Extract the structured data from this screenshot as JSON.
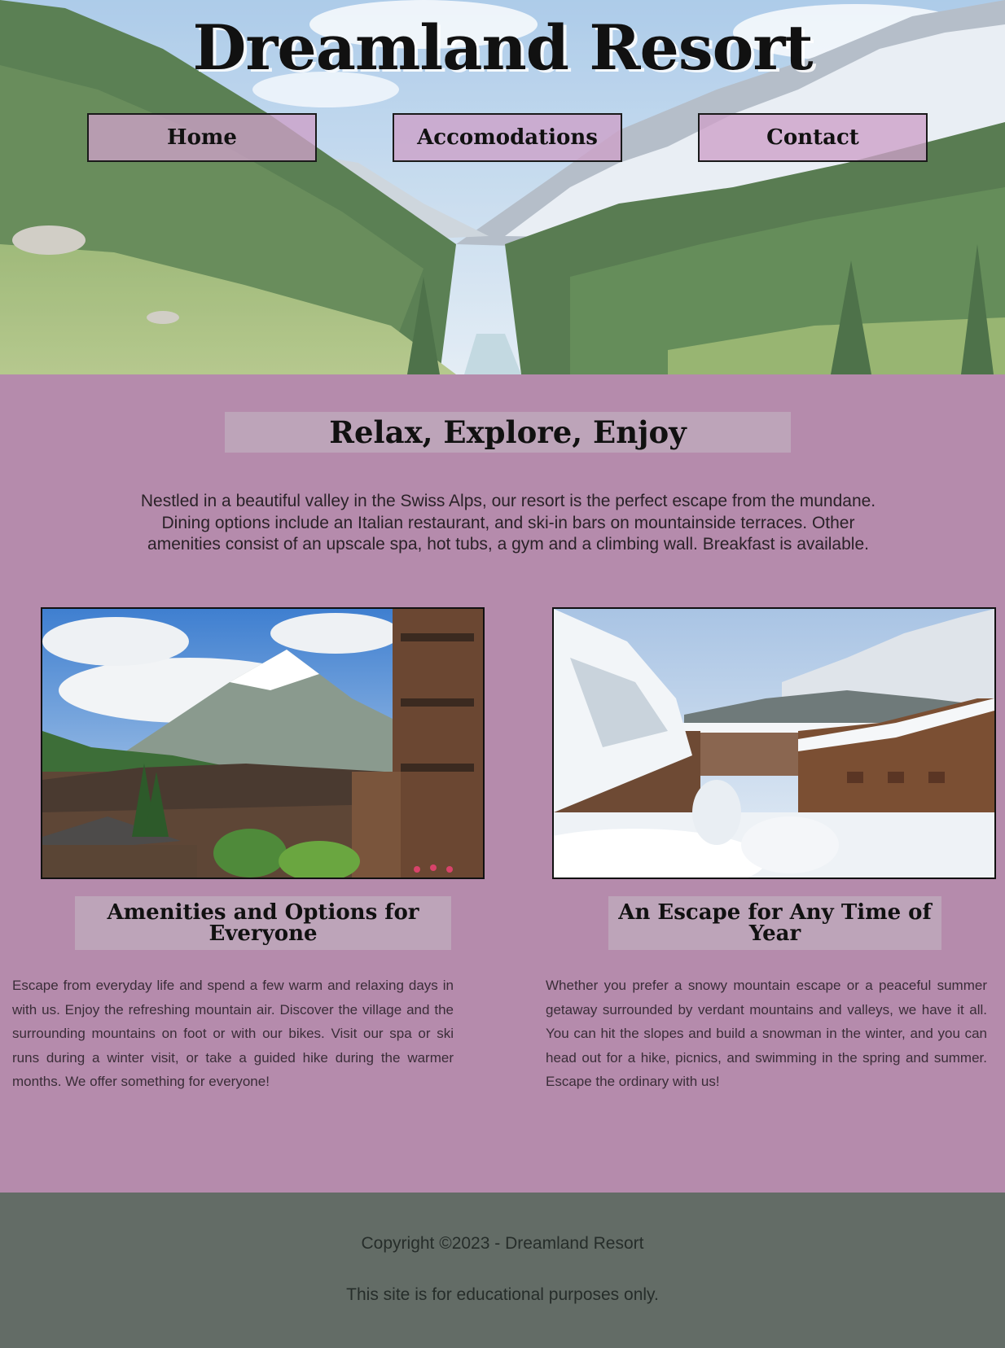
{
  "header": {
    "title": "Dreamland Resort",
    "nav": [
      {
        "label": "Home"
      },
      {
        "label": "Accomodations"
      },
      {
        "label": "Contact"
      }
    ]
  },
  "main": {
    "heading": "Relax, Explore, Enjoy",
    "intro": "Nestled in a beautiful valley in the Swiss Alps, our resort is the perfect escape from the mundane. Dining options include an Italian restaurant, and ski-in bars on mountainside terraces. Other amenities consist of an upscale spa, hot tubs, a gym and a climbing wall. Breakfast is available.",
    "cards": [
      {
        "image": "alpine-village-summer-photo",
        "title": "Amenities and Options for Everyone",
        "text": "Escape from everyday life and spend a few warm and relaxing days in with us. Enjoy the refreshing mountain air. Discover the village and the surrounding mountains on foot or with our bikes. Visit our spa or ski runs during a winter visit, or take a guided hike during the warmer months. We offer something for everyone!"
      },
      {
        "image": "alpine-village-winter-photo",
        "title": "An Escape for Any Time of Year",
        "text": "Whether you prefer a snowy mountain escape or a peaceful summer getaway surrounded by verdant mountains and valleys, we have it all. You can hit the slopes and build a snowman in the winter, and you can head out for a hike, picnics, and swimming in the spring and summer. Escape the ordinary with us!"
      }
    ]
  },
  "footer": {
    "copyright": "Copyright ©2023 - Dreamland Resort",
    "note": "This site is for educational purposes only."
  },
  "colors": {
    "page_background": "#b58bac",
    "heading_box": "#bda4b9",
    "nav_button": "#cda0c8",
    "footer": "#636c66"
  }
}
